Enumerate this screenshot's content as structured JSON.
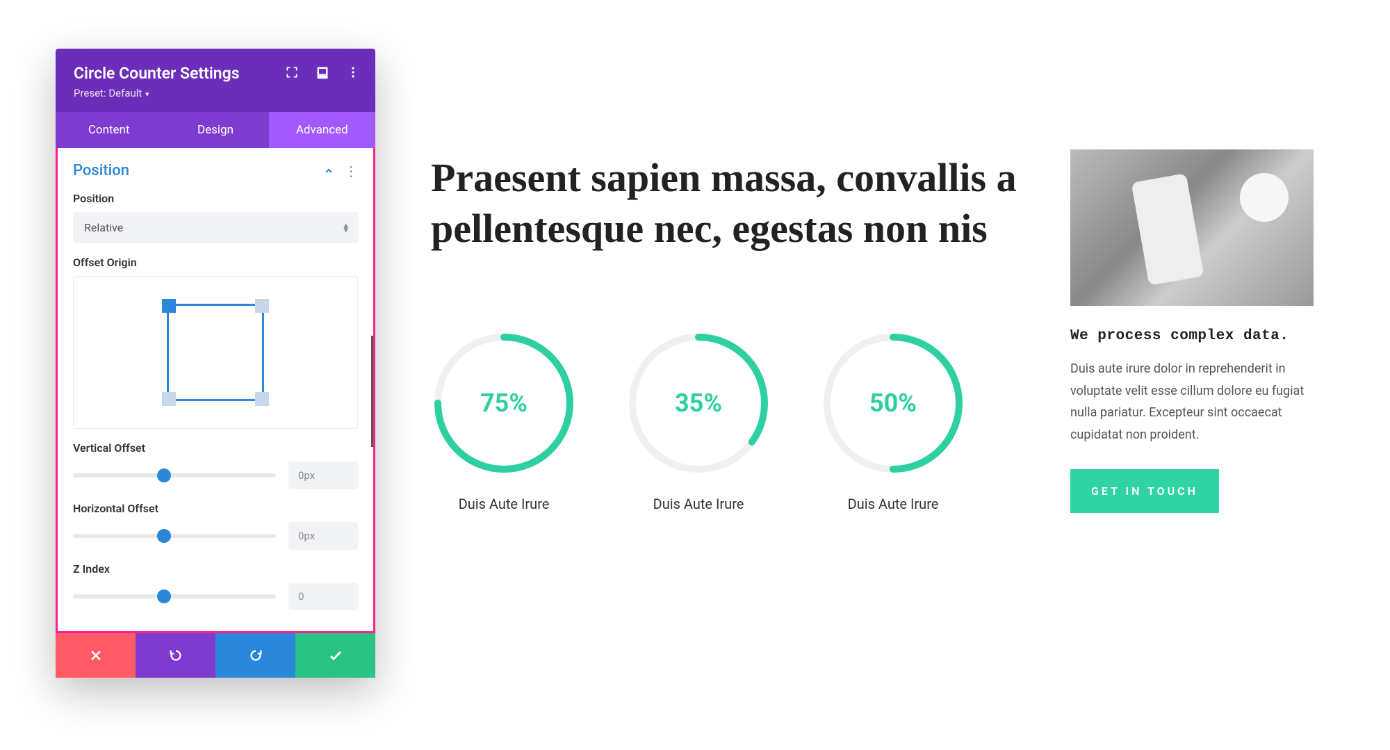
{
  "panel": {
    "title": "Circle Counter Settings",
    "preset_prefix": "Preset: ",
    "preset_value": "Default",
    "tabs": {
      "content": "Content",
      "design": "Design",
      "advanced": "Advanced"
    },
    "section": "Position",
    "labels": {
      "position": "Position",
      "offset_origin": "Offset Origin",
      "vertical_offset": "Vertical Offset",
      "horizontal_offset": "Horizontal Offset",
      "z_index": "Z Index"
    },
    "values": {
      "position_select": "Relative",
      "vertical_offset": "0px",
      "horizontal_offset": "0px",
      "z_index": "0"
    }
  },
  "page": {
    "headline": "Praesent sapien massa, convallis a pellentesque nec, egestas non nis",
    "counter_caption": "Duis Aute Irure",
    "sidebar": {
      "title": "We process complex data.",
      "body": "Duis aute irure dolor in reprehenderit in voluptate velit esse cillum dolore eu fugiat nulla pariatur. Excepteur sint occaecat cupidatat non proident.",
      "cta": "GET IN TOUCH"
    }
  },
  "chart_data": [
    {
      "type": "pie",
      "title": "Duis Aute Irure",
      "values": [
        75,
        25
      ],
      "display": "75%",
      "percent": 75
    },
    {
      "type": "pie",
      "title": "Duis Aute Irure",
      "values": [
        35,
        65
      ],
      "display": "35%",
      "percent": 35
    },
    {
      "type": "pie",
      "title": "Duis Aute Irure",
      "values": [
        50,
        50
      ],
      "display": "50%",
      "percent": 50
    }
  ],
  "colors": {
    "panel_header": "#6c2eb9",
    "tab_bg": "#7e3bd0",
    "tab_active": "#a259ff",
    "highlight_border": "#ff1f8f",
    "link": "#2b87da",
    "accent_green": "#2ecfa0",
    "cta_green": "#30d3a3",
    "danger": "#ff5a65"
  }
}
